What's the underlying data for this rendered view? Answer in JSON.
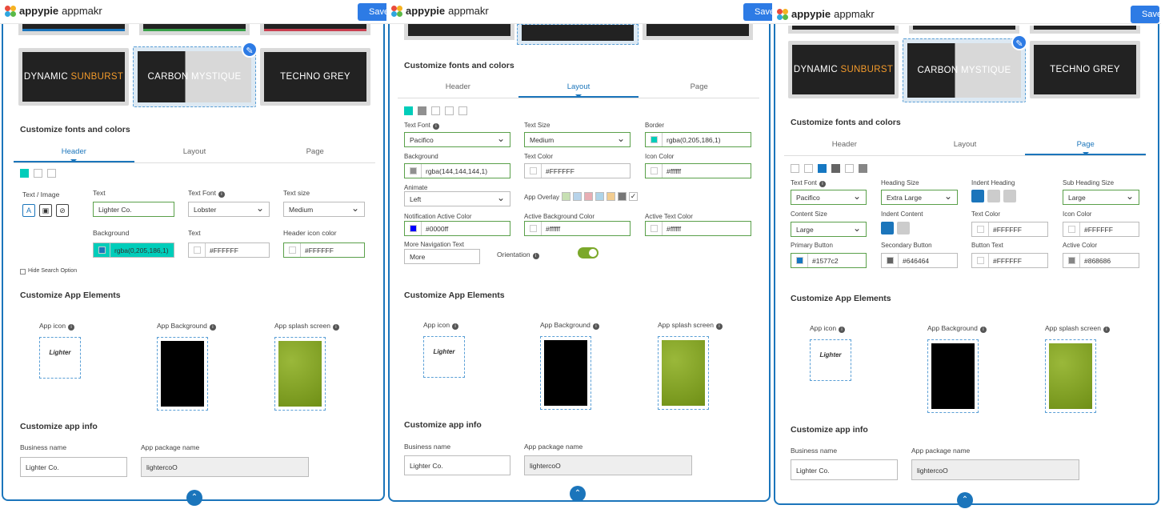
{
  "app": {
    "logo_text": "appypie",
    "logo_sub": "appmakr",
    "save": "Save"
  },
  "themes": {
    "dynamic": {
      "a": "DYNAMIC ",
      "b": "SUNBURST"
    },
    "carbon": {
      "a": "CARBON ",
      "b": "MYSTIQUE"
    },
    "techno": "TECHNO GREY"
  },
  "sections": {
    "fonts": "Customize fonts and colors",
    "elements": "Customize App Elements",
    "info": "Customize app info"
  },
  "tabs": [
    "Header",
    "Layout",
    "Page"
  ],
  "header": {
    "text_image": "Text / Image",
    "text": "Text",
    "text_value": "Lighter Co.",
    "text_font": "Text Font",
    "text_font_value": "Lobster",
    "text_size": "Text size",
    "text_size_value": "Medium",
    "background": "Background",
    "background_value": "rgba(0,205,186,1)",
    "text_color": "Text",
    "text_color_value": "#FFFFFF",
    "icon_color": "Header icon color",
    "icon_color_value": "#FFFFFF",
    "hide_search": "Hide Search Option"
  },
  "layout": {
    "text_font": "Text Font",
    "text_font_value": "Pacifico",
    "text_size": "Text Size",
    "text_size_value": "Medium",
    "border": "Border",
    "border_value": "rgba(0,205,186,1)",
    "background": "Background",
    "background_value": "rgba(144,144,144,1)",
    "text_color": "Text Color",
    "text_color_value": "#FFFFFF",
    "icon_color": "Icon Color",
    "icon_color_value": "#ffffff",
    "animate": "Animate",
    "animate_value": "Left",
    "overlay": "App Overlay",
    "notif": "Notification Active Color",
    "notif_value": "#0000ff",
    "active_bg": "Active Background Color",
    "active_bg_value": "#ffffff",
    "active_text": "Active Text Color",
    "active_text_value": "#ffffff",
    "more_nav": "More Navigation Text",
    "more_nav_value": "More",
    "orientation": "Orientation"
  },
  "page": {
    "text_font": "Text Font",
    "text_font_value": "Pacifico",
    "heading_size": "Heading Size",
    "heading_size_value": "Extra Large",
    "indent_heading": "Indent Heading",
    "sub_heading_size": "Sub Heading Size",
    "sub_heading_size_value": "Large",
    "content_size": "Content Size",
    "content_size_value": "Large",
    "indent_content": "Indent Content",
    "text_color": "Text Color",
    "text_color_value": "#FFFFFF",
    "icon_color": "Icon Color",
    "icon_color_value": "#FFFFFF",
    "primary": "Primary Button",
    "primary_value": "#1577c2",
    "secondary": "Secondary Button",
    "secondary_value": "#646464",
    "button_text": "Button Text",
    "button_text_value": "#FFFFFF",
    "active": "Active Color",
    "active_value": "#868686"
  },
  "elements": {
    "icon": "App icon",
    "bg": "App Background",
    "splash": "App splash screen",
    "icon_text": "Lighter"
  },
  "info": {
    "business": "Business name",
    "business_value": "Lighter Co.",
    "package": "App package name",
    "package_value": "lightercoO"
  }
}
